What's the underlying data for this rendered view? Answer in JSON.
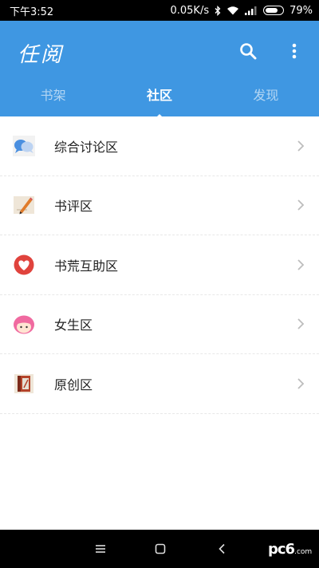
{
  "status_bar": {
    "time": "下午3:52",
    "net_speed": "0.05K/s",
    "battery": "79%"
  },
  "app_bar": {
    "title": "任阅",
    "color": "#3f97e2",
    "tabs": [
      {
        "label": "书架",
        "active": false
      },
      {
        "label": "社区",
        "active": true
      },
      {
        "label": "发现",
        "active": false
      }
    ]
  },
  "forums": [
    {
      "label": "综合讨论区",
      "icon": "chat-bubble-icon"
    },
    {
      "label": "书评区",
      "icon": "pencil-paper-icon"
    },
    {
      "label": "书荒互助区",
      "icon": "heart-icon"
    },
    {
      "label": "女生区",
      "icon": "girl-face-icon"
    },
    {
      "label": "原创区",
      "icon": "book-icon"
    }
  ],
  "watermark": {
    "main": "pc6",
    "sub": ".com"
  }
}
